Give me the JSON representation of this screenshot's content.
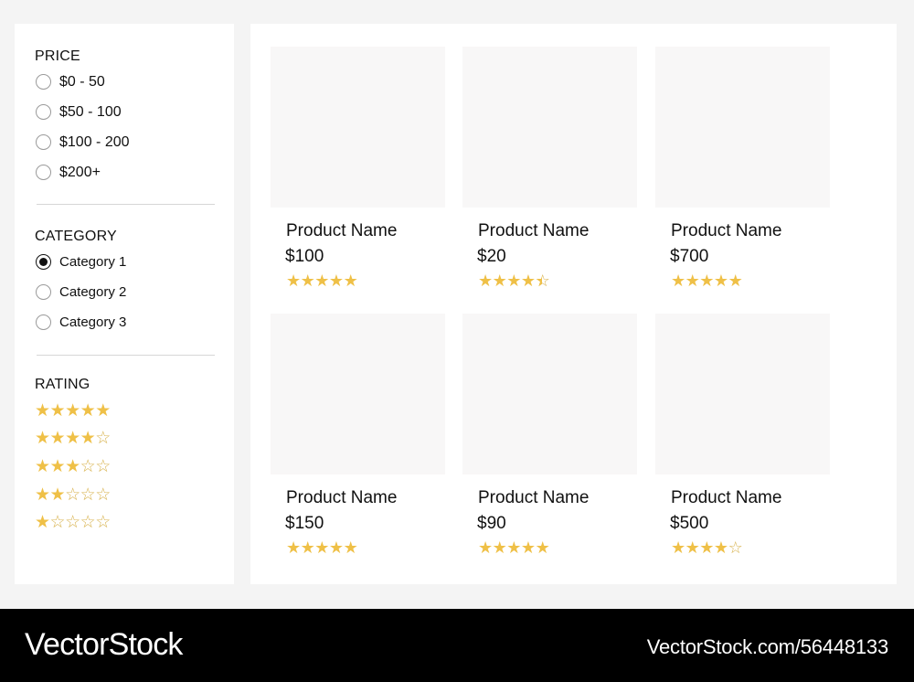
{
  "filters": {
    "price": {
      "title": "PRICE",
      "options": [
        {
          "label": "$0 - 50",
          "checked": false
        },
        {
          "label": "$50 - 100",
          "checked": false
        },
        {
          "label": "$100 - 200",
          "checked": false
        },
        {
          "label": "$200+",
          "checked": false
        }
      ]
    },
    "category": {
      "title": "CATEGORY",
      "options": [
        {
          "label": "Category 1",
          "checked": true
        },
        {
          "label": "Category 2",
          "checked": false
        },
        {
          "label": "Category 3",
          "checked": false
        }
      ]
    },
    "rating": {
      "title": "RATING",
      "options": [
        {
          "stars": 5
        },
        {
          "stars": 4
        },
        {
          "stars": 3
        },
        {
          "stars": 2
        },
        {
          "stars": 1
        }
      ]
    }
  },
  "products": [
    {
      "name": "Product Name",
      "price": "$100",
      "rating": 5
    },
    {
      "name": "Product Name",
      "price": "$20",
      "rating": 4.5
    },
    {
      "name": "Product Name",
      "price": "$700",
      "rating": 5
    },
    {
      "name": "Product Name",
      "price": "$150",
      "rating": 5
    },
    {
      "name": "Product Name",
      "price": "$90",
      "rating": 5
    },
    {
      "name": "Product Name",
      "price": "$500",
      "rating": 4
    }
  ],
  "banner": {
    "logo": "VectorStock",
    "url": "VectorStock.com/56448133"
  },
  "colors": {
    "star": "#efc047",
    "card_placeholder": "#f8f7f7",
    "page_background": "#f4f4f4"
  }
}
